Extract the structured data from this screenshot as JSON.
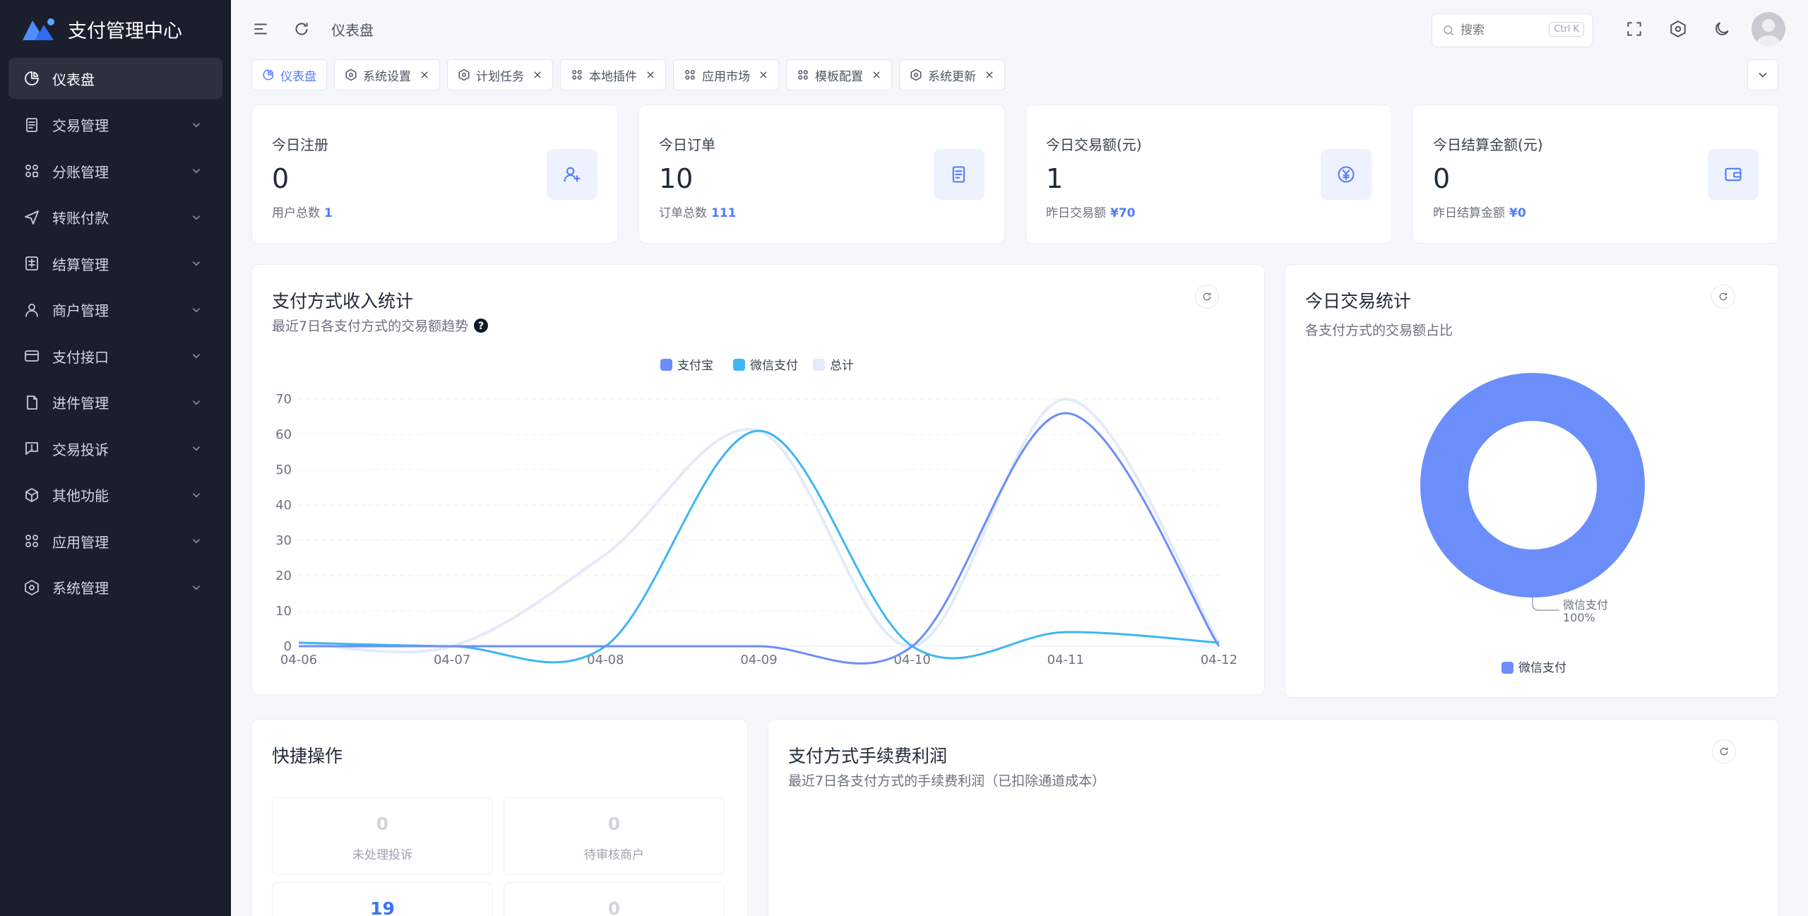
{
  "app": {
    "title": "支付管理中心"
  },
  "colors": {
    "accent": "#4f7cff",
    "alipay": "#6b8efb",
    "wechat": "#3fb6f1",
    "total": "#e3eaf9",
    "sidebar": "#1b1e2c"
  },
  "sidebar": {
    "items": [
      {
        "label": "仪表盘",
        "icon": "pie-chart-icon",
        "active": true
      },
      {
        "label": "交易管理",
        "icon": "receipt-icon"
      },
      {
        "label": "分账管理",
        "icon": "split-icon"
      },
      {
        "label": "转账付款",
        "icon": "send-icon"
      },
      {
        "label": "结算管理",
        "icon": "settlement-icon"
      },
      {
        "label": "商户管理",
        "icon": "user-icon"
      },
      {
        "label": "支付接口",
        "icon": "card-icon"
      },
      {
        "label": "进件管理",
        "icon": "document-icon"
      },
      {
        "label": "交易投诉",
        "icon": "complaint-icon"
      },
      {
        "label": "其他功能",
        "icon": "box-icon"
      },
      {
        "label": "应用管理",
        "icon": "apps-icon"
      },
      {
        "label": "系统管理",
        "icon": "gear-icon"
      }
    ]
  },
  "topbar": {
    "breadcrumb": "仪表盘",
    "search_placeholder": "搜索",
    "search_shortcut": "Ctrl K"
  },
  "tabs": [
    {
      "label": "仪表盘",
      "active": true,
      "closable": false
    },
    {
      "label": "系统设置",
      "closable": true
    },
    {
      "label": "计划任务",
      "closable": true
    },
    {
      "label": "本地插件",
      "closable": true
    },
    {
      "label": "应用市场",
      "closable": true
    },
    {
      "label": "模板配置",
      "closable": true
    },
    {
      "label": "系统更新",
      "closable": true
    }
  ],
  "stats": [
    {
      "label": "今日注册",
      "value": "0",
      "sub_label": "用户总数",
      "sub_value": "1",
      "icon": "user-plus-icon"
    },
    {
      "label": "今日订单",
      "value": "10",
      "sub_label": "订单总数",
      "sub_value": "111",
      "icon": "order-icon"
    },
    {
      "label": "今日交易额(元)",
      "value": "1",
      "sub_label": "昨日交易额",
      "sub_value": "¥70",
      "icon": "yuan-icon"
    },
    {
      "label": "今日结算金额(元)",
      "value": "0",
      "sub_label": "昨日结算金额",
      "sub_value": "¥0",
      "icon": "wallet-icon"
    }
  ],
  "income_panel": {
    "title": "支付方式收入统计",
    "subtitle": "最近7日各支付方式的交易额趋势"
  },
  "today_panel": {
    "title": "今日交易统计",
    "subtitle": "各支付方式的交易额占比"
  },
  "quick_panel": {
    "title": "快捷操作",
    "items": [
      {
        "value": "0",
        "label": "未处理投诉",
        "highlight": false
      },
      {
        "value": "0",
        "label": "待审核商户",
        "highlight": false
      },
      {
        "value": "19",
        "label": "",
        "highlight": true
      },
      {
        "value": "0",
        "label": "",
        "highlight": false
      }
    ]
  },
  "fee_panel": {
    "title": "支付方式手续费利润",
    "subtitle": "最近7日各支付方式的手续费利润（已扣除通道成本）"
  },
  "chart_data": [
    {
      "type": "line",
      "x": [
        "04-06",
        "04-07",
        "04-08",
        "04-09",
        "04-10",
        "04-11",
        "04-12"
      ],
      "ylim": [
        0,
        70
      ],
      "yticks": [
        0,
        10,
        20,
        30,
        40,
        50,
        60,
        70
      ],
      "legend_position": "top-center",
      "grid": true,
      "series": [
        {
          "name": "支付宝",
          "color": "#6b8efb",
          "values": [
            0,
            0,
            0,
            0,
            0,
            66,
            0
          ]
        },
        {
          "name": "微信支付",
          "color": "#3fb6f1",
          "values": [
            1,
            0,
            0,
            61,
            0,
            4,
            1
          ]
        },
        {
          "name": "总计",
          "color": "#e3eaf9",
          "values": [
            1,
            0,
            26,
            61,
            0,
            70,
            1
          ]
        }
      ]
    },
    {
      "type": "pie",
      "slices": [
        {
          "name": "微信支付",
          "value": 100,
          "label": "微信支付",
          "percent_label": "100%",
          "color": "#6b8efb"
        }
      ],
      "legend_position": "bottom-center"
    }
  ]
}
